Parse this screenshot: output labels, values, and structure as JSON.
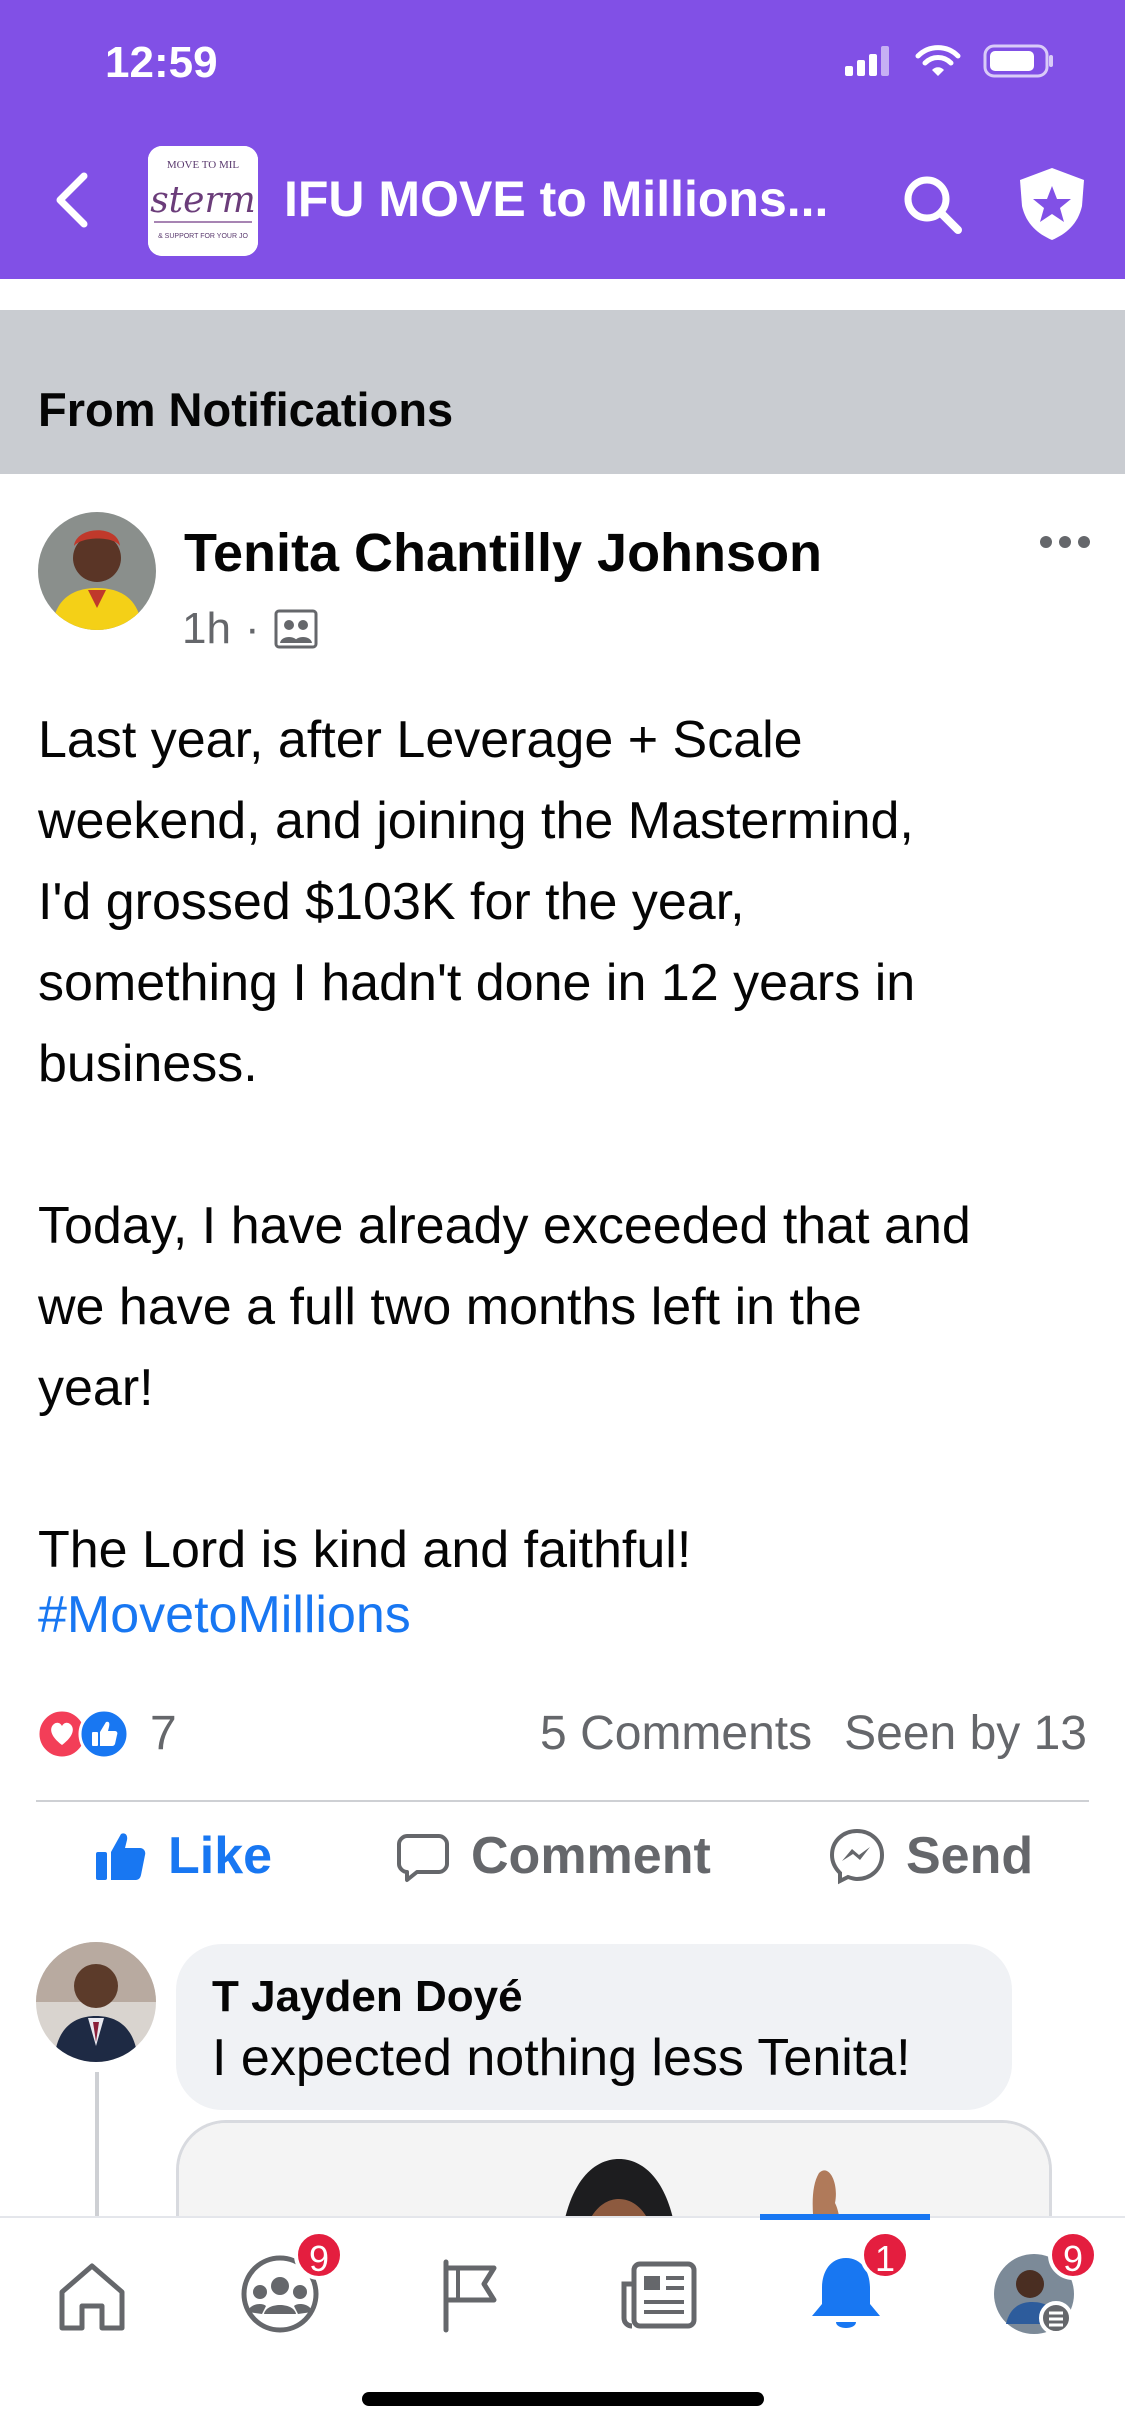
{
  "status_bar": {
    "time": "12:59"
  },
  "header": {
    "group_title": "IFU MOVE to Millions...",
    "logo_text_top": "MOVE TO MIL",
    "logo_text_mid": "sterm",
    "logo_text_bottom": "& SUPPORT FOR YOUR JO"
  },
  "banner": {
    "text": "From Notifications"
  },
  "post": {
    "author": "Tenita Chantilly Johnson",
    "time": "1h",
    "separator": "·",
    "body_1": "Last year, after Leverage + Scale\nweekend, and joining the Mastermind,\nI'd grossed $103K for the year,\nsomething I hadn't done in 12 years in\nbusiness.",
    "body_2": "Today, I have already exceeded that and\nwe have a full two months left in the\nyear!",
    "body_3": "The Lord is kind and faithful!",
    "hashtag": "#MovetoMillions",
    "reaction_count": "7",
    "comments": "5 Comments",
    "seen_by": "Seen by 13"
  },
  "actions": {
    "like": "Like",
    "comment": "Comment",
    "send": "Send"
  },
  "comment": {
    "author": "T Jayden Doyé",
    "text": "I expected nothing less Tenita!"
  },
  "tabbar": {
    "groups_badge": "9",
    "notifications_badge": "1",
    "menu_badge": "9"
  },
  "colors": {
    "header_purple": "#8150E6",
    "facebook_blue": "#1877F2",
    "badge_red": "#E41E3F",
    "banner_gray": "#C9CCD1"
  }
}
